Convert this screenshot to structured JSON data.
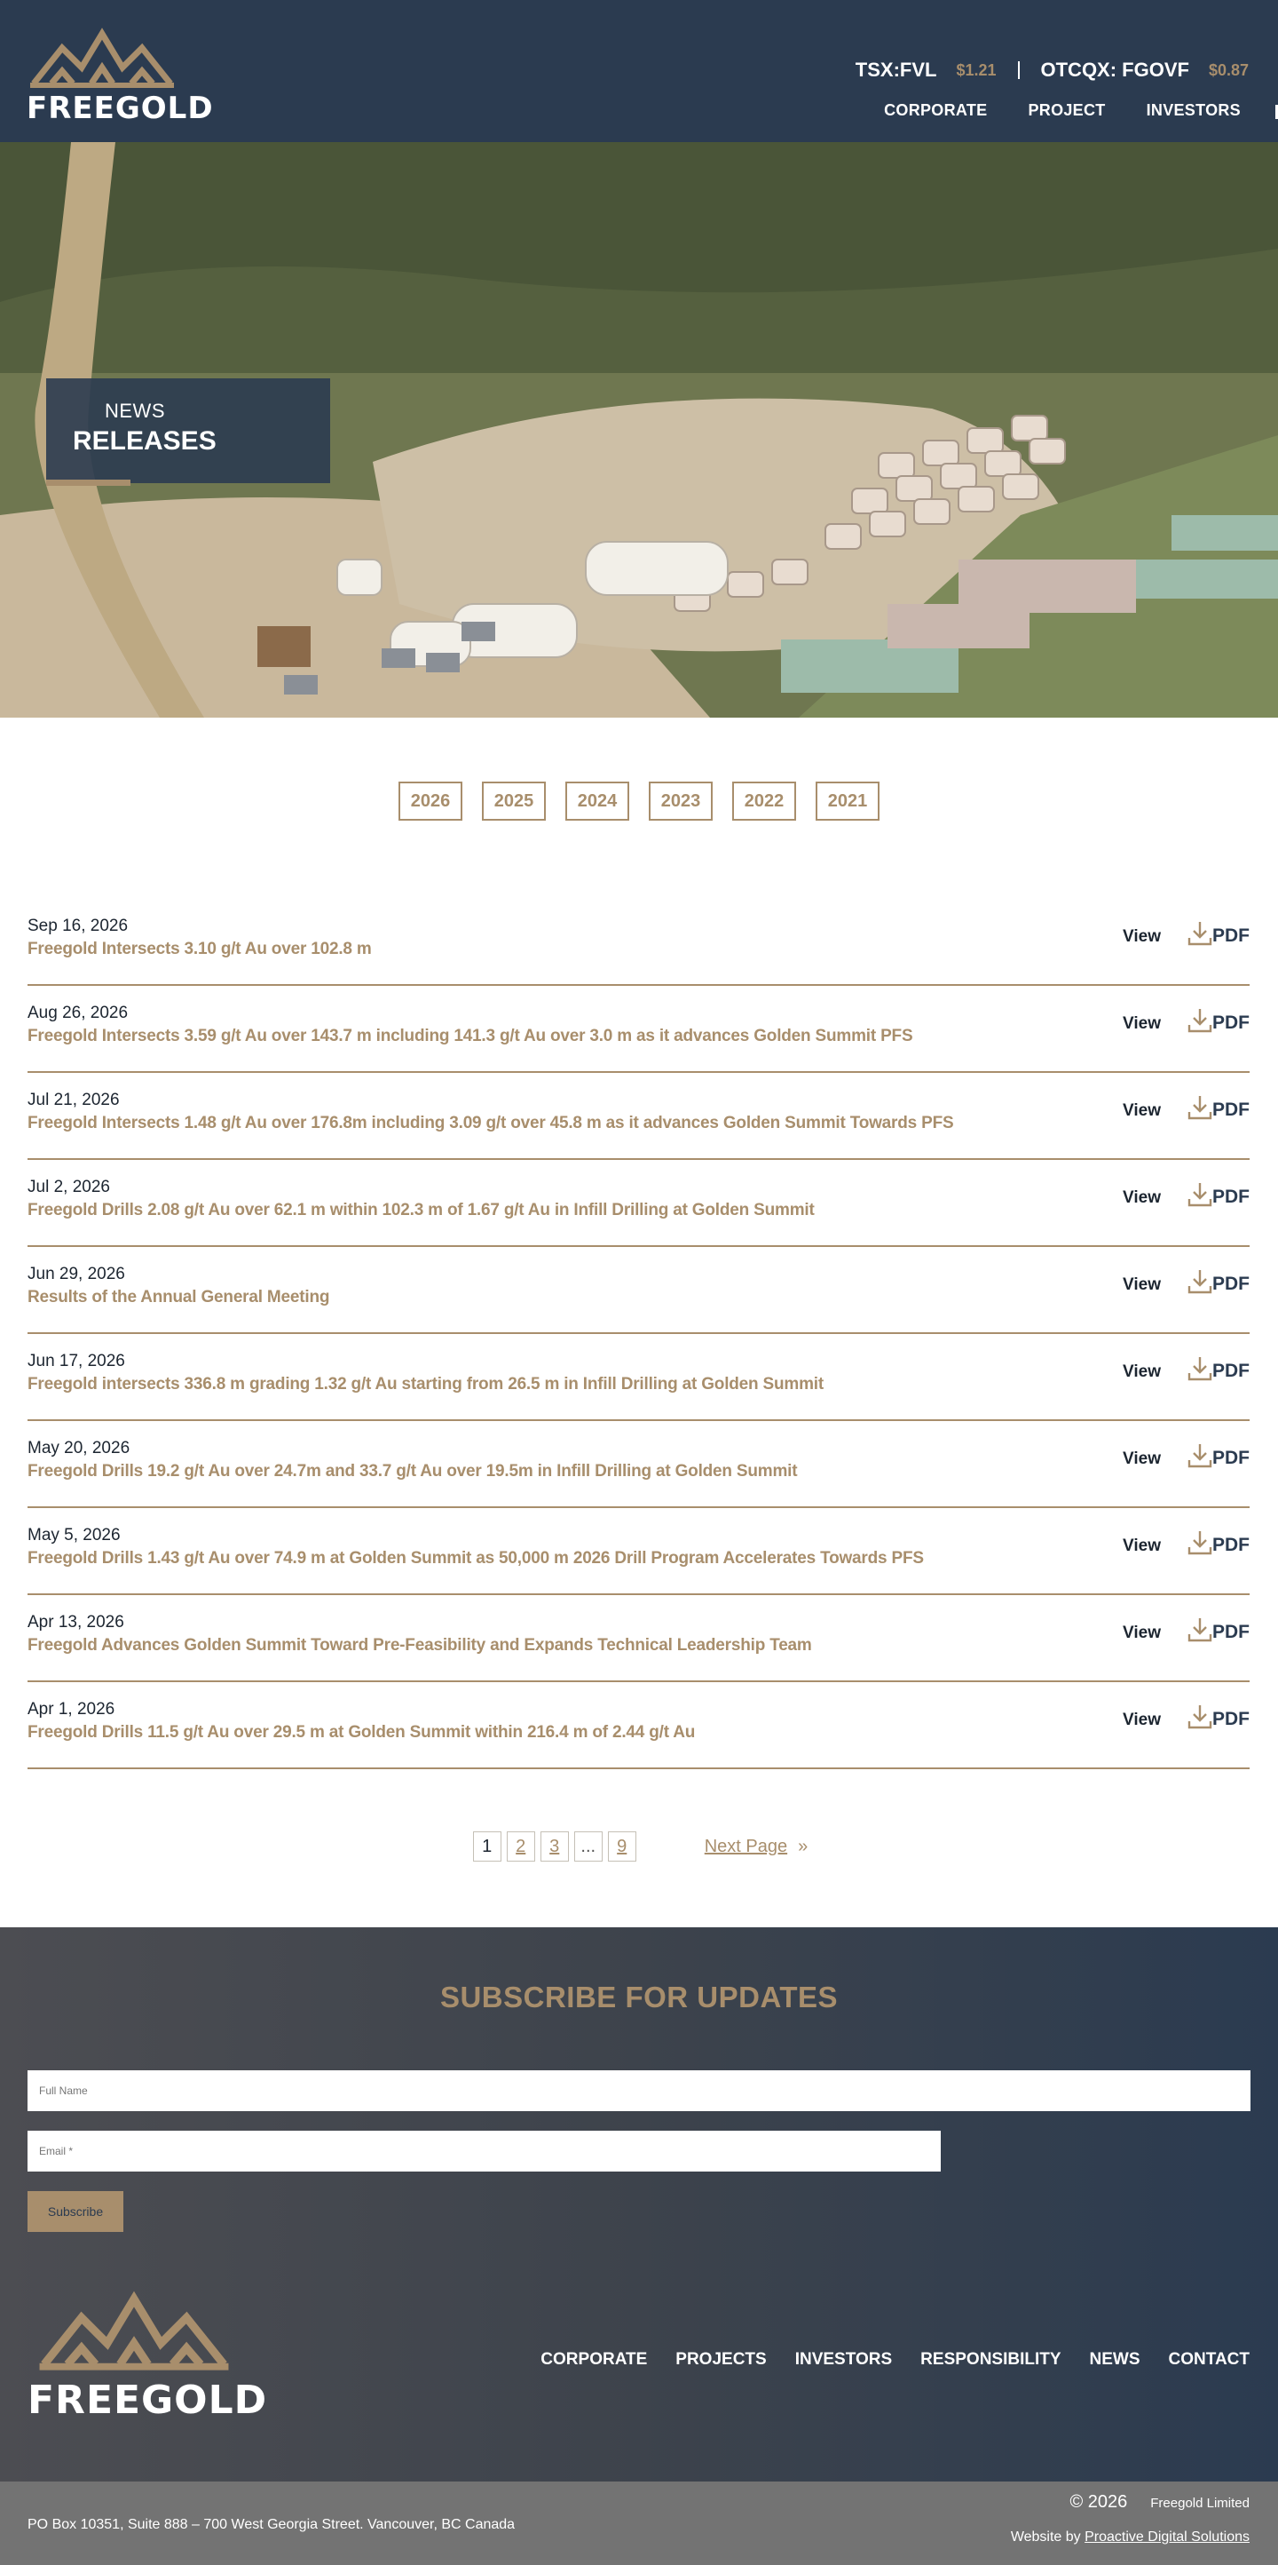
{
  "header": {
    "brand": "FREEGOLD",
    "tickers": [
      {
        "symbol": "TSX:FVL",
        "price": "$1.21"
      },
      {
        "symbol": "OTCQX: FGOVF",
        "price": "$0.87"
      }
    ],
    "nav": [
      "CORPORATE",
      "PROJECT",
      "INVESTORS"
    ]
  },
  "hero": {
    "small": "NEWS",
    "big": "RELEASES"
  },
  "years": [
    "2026",
    "2025",
    "2024",
    "2023",
    "2022",
    "2021"
  ],
  "news": [
    {
      "date": "Sep 16, 2026",
      "title": "Freegold Intersects 3.10 g/t Au over 102.8 m",
      "view": "View",
      "pdf": "PDF"
    },
    {
      "date": "Aug 26, 2026",
      "title": "Freegold Intersects 3.59 g/t Au over 143.7 m including 141.3 g/t Au over 3.0 m as it advances Golden Summit PFS",
      "view": "View",
      "pdf": "PDF"
    },
    {
      "date": "Jul 21, 2026",
      "title": "Freegold Intersects 1.48 g/t Au over 176.8m including 3.09 g/t over 45.8 m as it advances Golden Summit Towards PFS",
      "view": "View",
      "pdf": "PDF"
    },
    {
      "date": "Jul 2, 2026",
      "title": "Freegold Drills 2.08 g/t Au over 62.1 m within 102.3 m of 1.67 g/t Au in Infill Drilling at Golden Summit",
      "view": "View",
      "pdf": "PDF"
    },
    {
      "date": "Jun 29, 2026",
      "title": "Results of the Annual General Meeting",
      "view": "View",
      "pdf": "PDF"
    },
    {
      "date": "Jun 17, 2026",
      "title": "Freegold intersects 336.8 m grading 1.32 g/t Au starting from 26.5 m in Infill Drilling at Golden Summit",
      "view": "View",
      "pdf": "PDF"
    },
    {
      "date": "May 20, 2026",
      "title": "Freegold Drills 19.2 g/t Au over 24.7m and 33.7 g/t Au over 19.5m in Infill Drilling at Golden Summit",
      "view": "View",
      "pdf": "PDF"
    },
    {
      "date": "May 5, 2026",
      "title": "Freegold Drills 1.43 g/t Au over 74.9 m at Golden Summit as 50,000 m 2026 Drill Program Accelerates Towards PFS",
      "view": "View",
      "pdf": "PDF"
    },
    {
      "date": "Apr 13, 2026",
      "title": "Freegold Advances Golden Summit Toward Pre-Feasibility and Expands Technical Leadership Team",
      "view": "View",
      "pdf": "PDF"
    },
    {
      "date": "Apr 1, 2026",
      "title": "Freegold Drills 11.5 g/t Au over 29.5 m at Golden Summit within 216.4 m of 2.44 g/t Au",
      "view": "View",
      "pdf": "PDF"
    }
  ],
  "pagination": {
    "pages": [
      "1",
      "2",
      "3",
      "...",
      "9"
    ],
    "next": "Next Page",
    "next_arrow": "»"
  },
  "subscribe": {
    "title": "SUBSCRIBE FOR UPDATES",
    "name_placeholder": "Full Name",
    "email_placeholder": "Email *",
    "button": "Subscribe"
  },
  "footer": {
    "brand": "FREEGOLD",
    "nav": [
      "CORPORATE",
      "PROJECTS",
      "INVESTORS",
      "RESPONSIBILITY",
      "NEWS",
      "CONTACT"
    ],
    "address": "PO Box 10351, Suite 888 – 700 West Georgia Street. Vancouver, BC Canada",
    "copyright_year": "© 2026",
    "company": "Freegold Limited",
    "credit_prefix": "Website by",
    "credit_link": "Proactive Digital Solutions"
  },
  "colors": {
    "navy": "#2b3b50",
    "gold": "#a88e6c"
  }
}
